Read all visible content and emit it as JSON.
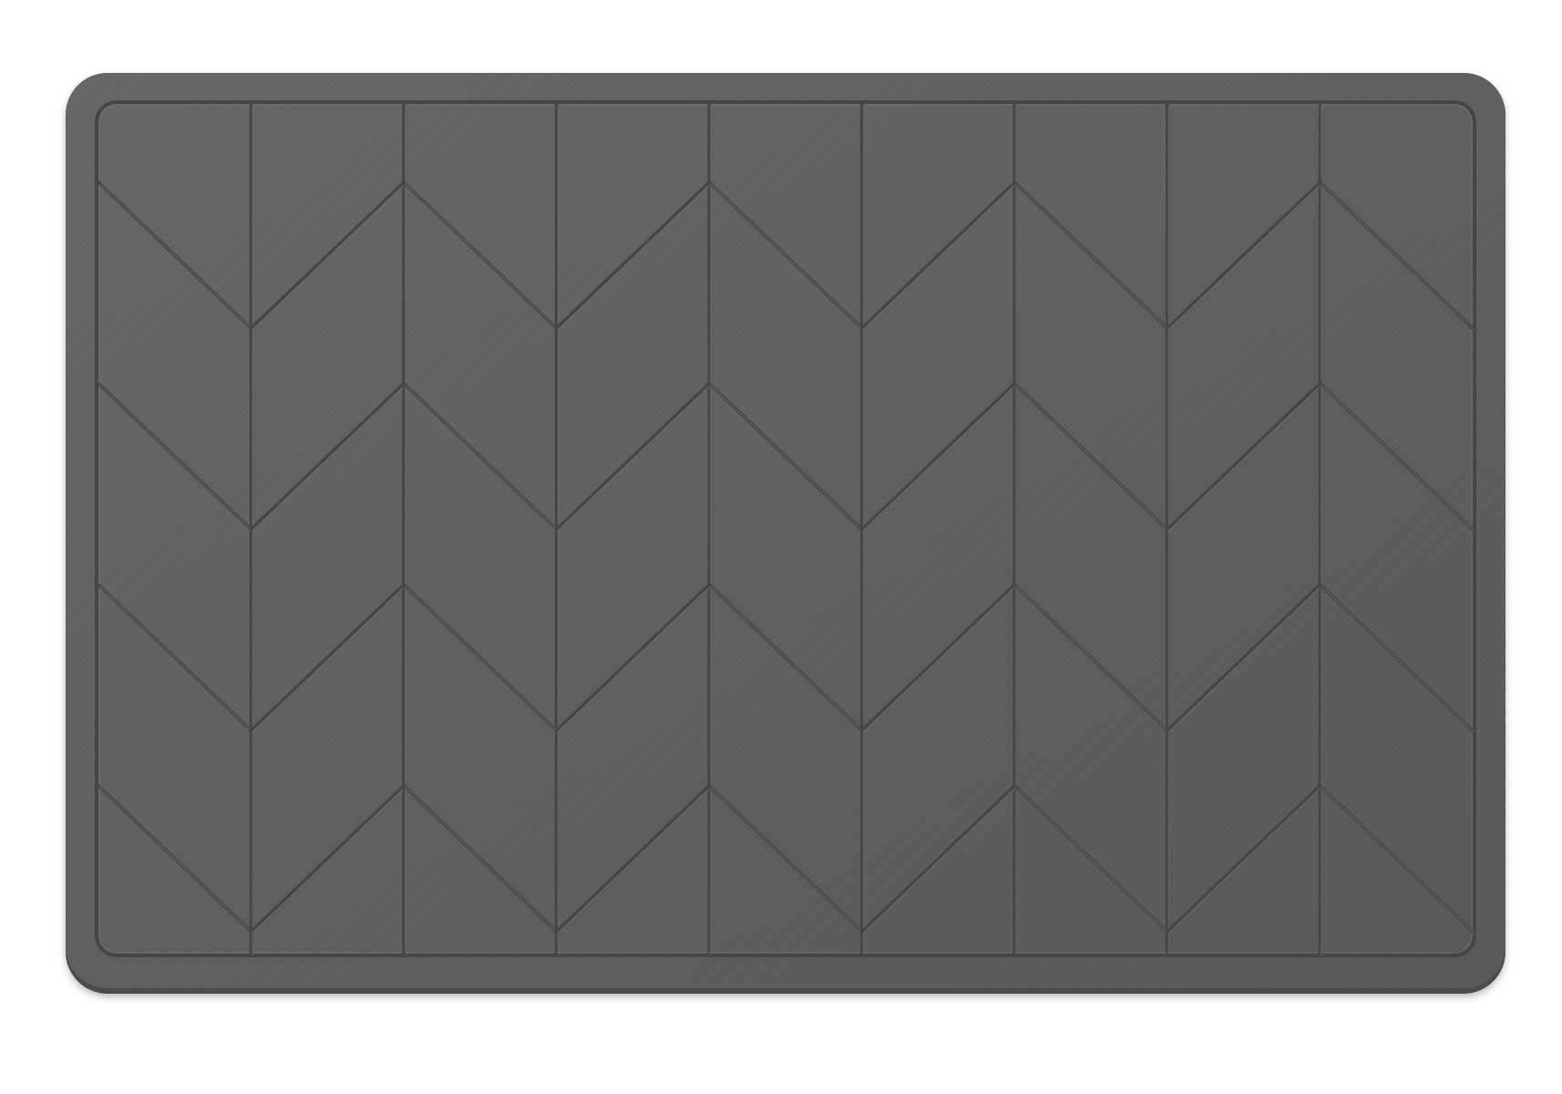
{
  "image": {
    "subject": "bath-mat",
    "colors": {
      "background": "#ffffff",
      "mat_base": "#5d5d5f",
      "mat_highlight": "#6a6a6c",
      "mat_edge_dark": "#454547",
      "groove_dark": "#434345",
      "groove_light": "#7a7a7c"
    },
    "pattern": {
      "type": "chevron",
      "vertical_strips": 9,
      "chevron_rows": 4
    }
  }
}
